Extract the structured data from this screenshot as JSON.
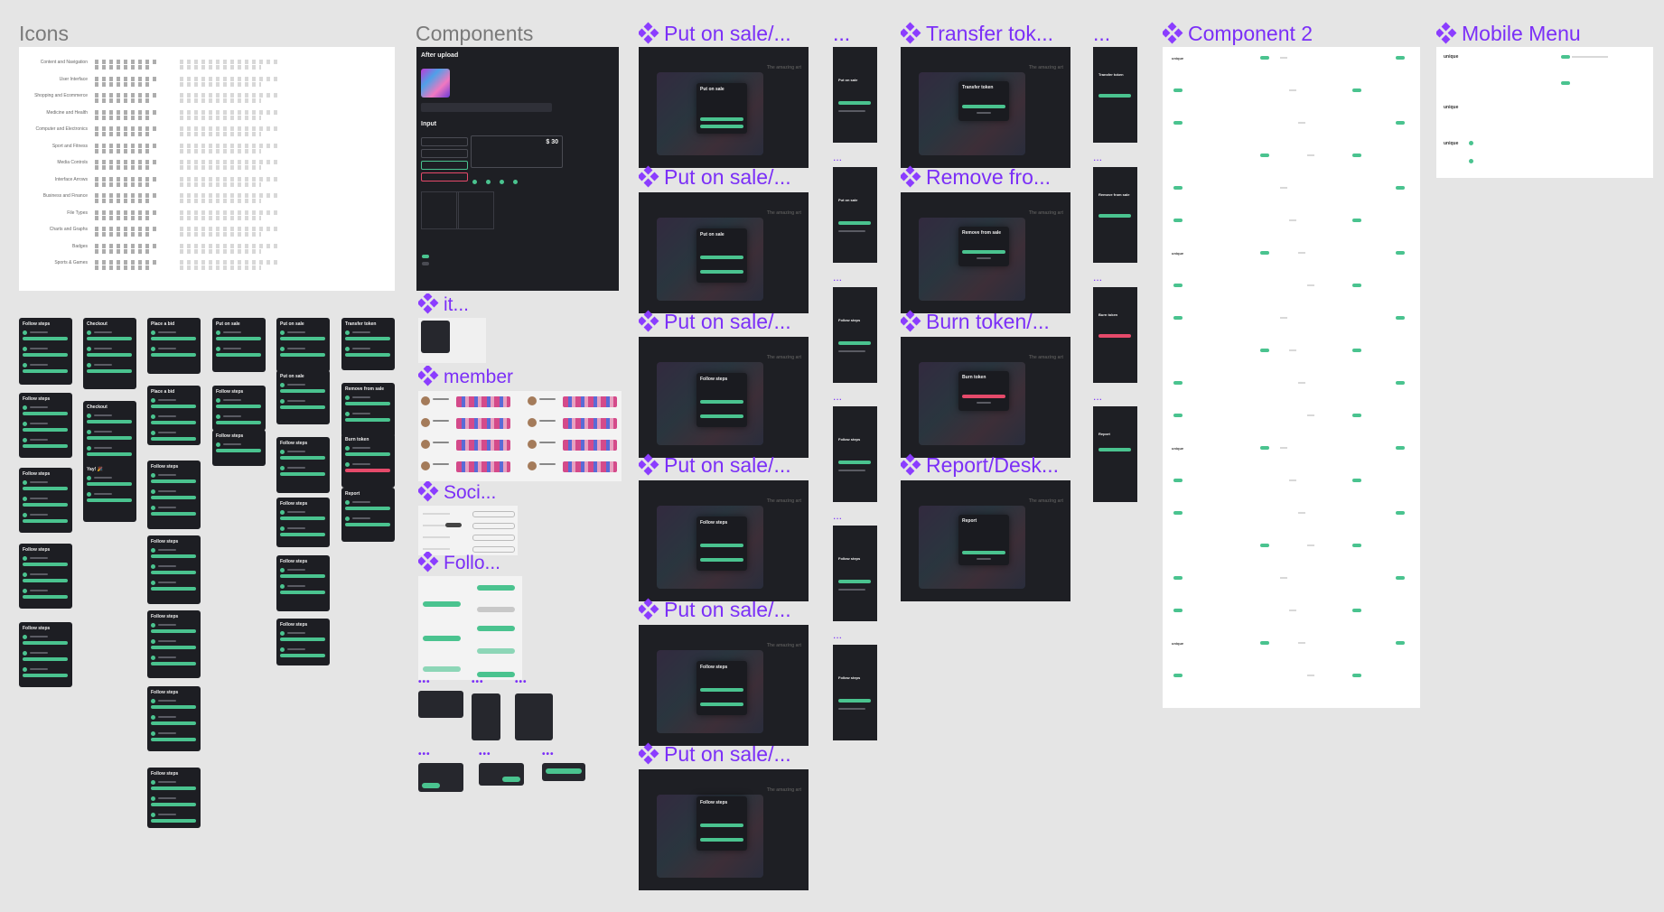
{
  "sections": {
    "icons": "Icons",
    "components": "Components",
    "put_on_sale": "Put on sale/...",
    "ellipsis": "...",
    "transfer": "Transfer tok...",
    "remove": "Remove fro...",
    "burn": "Burn token/...",
    "report": "Report/Desk...",
    "component2": "Component 2",
    "mobile_menu": "Mobile Menu",
    "it": "it...",
    "member": "member",
    "soci": "Soci...",
    "follo": "Follo..."
  },
  "icon_categories": [
    "Content and Navigation",
    "User Interface",
    "Shopping and Ecommerce",
    "Medicine and Health",
    "Computer and Electronics",
    "Sport and Fitness",
    "Media Controls",
    "Interface Arrows",
    "Business and Finance",
    "File Types",
    "Charts and Graphs",
    "Badges",
    "Sports & Games"
  ],
  "components_panel": {
    "after_upload": "After upload",
    "input": "Input",
    "price": "$ 30"
  },
  "modal_titles": {
    "put_on_sale": "Put on sale",
    "follow_steps": "Follow steps",
    "transfer_token": "Transfer token",
    "remove_from_sale": "Remove from sale",
    "burn_token": "Burn token",
    "report": "Report",
    "checkout": "Checkout",
    "place_a_bid": "Place a bid",
    "yay": "Yay! 🎉"
  },
  "labels": {
    "amazing_art": "The amazing art",
    "brand": "unique"
  },
  "colors": {
    "canvas": "#e5e5e5",
    "accent_purple": "#7b2ff7",
    "green": "#4ac38f",
    "red": "#e54a6a",
    "dark": "#1e1f24"
  }
}
